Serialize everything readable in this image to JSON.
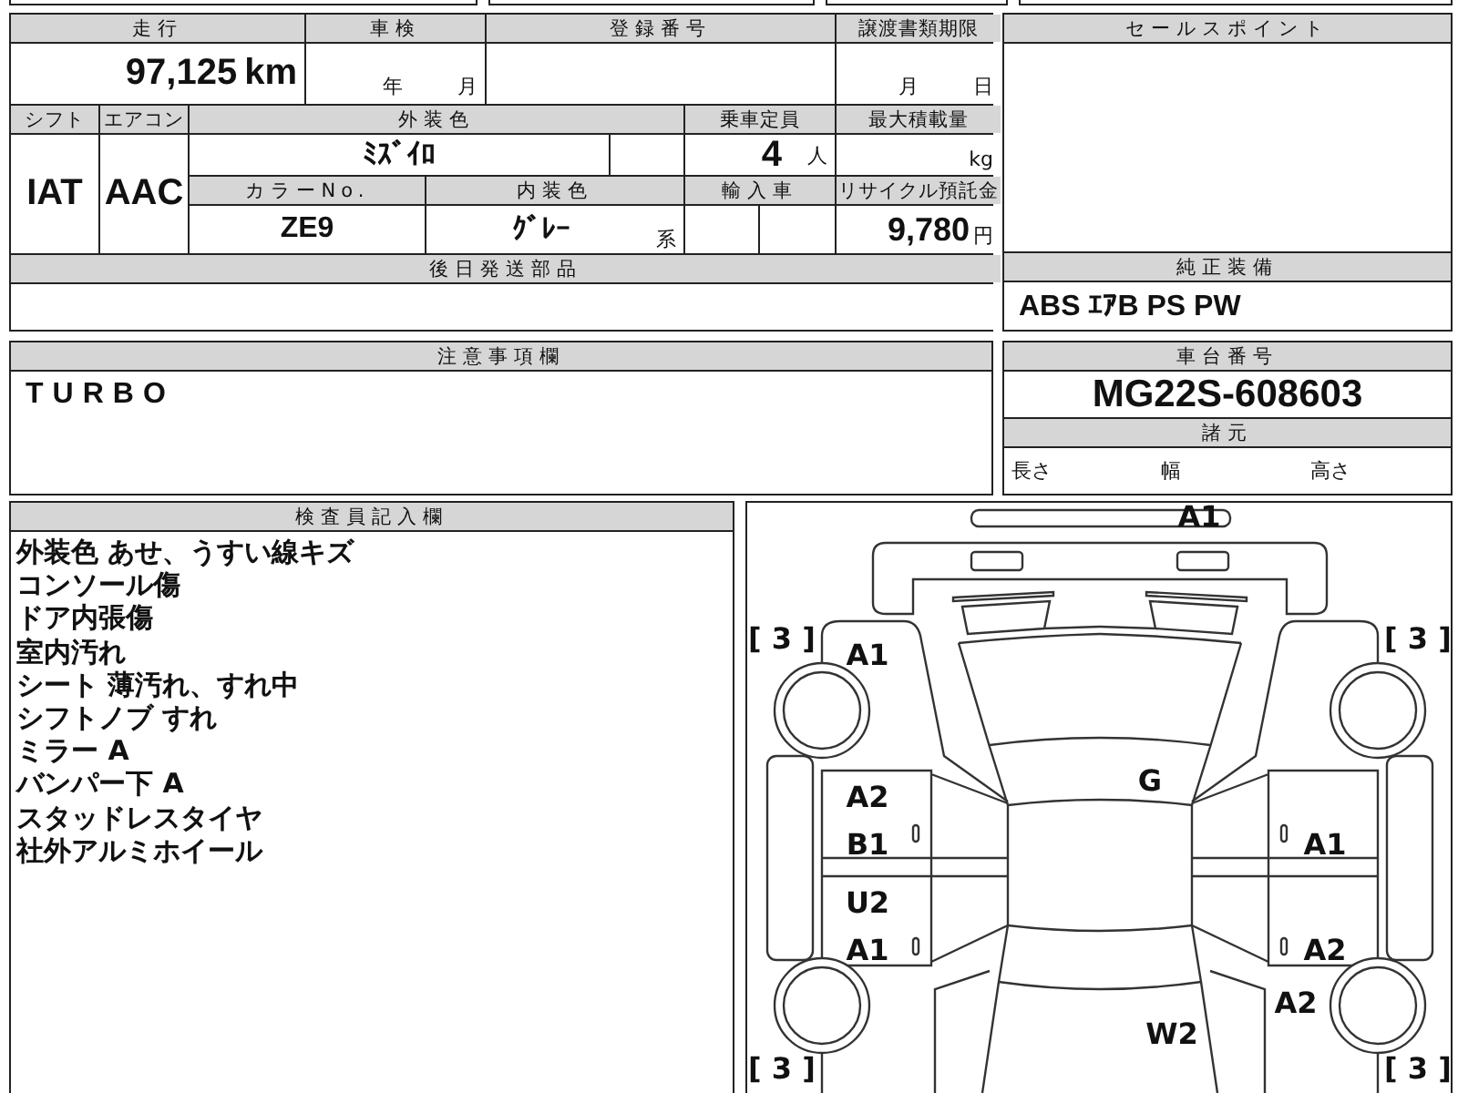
{
  "odometer": {
    "label": "走行",
    "value": "97,125",
    "unit": "km"
  },
  "inspection": {
    "label": "車検",
    "year_unit": "年",
    "month_unit": "月"
  },
  "registration": {
    "label": "登録番号"
  },
  "transfer_deadline": {
    "label": "譲渡書類期限",
    "month_unit": "月",
    "day_unit": "日"
  },
  "shift": {
    "label": "シフト",
    "value": "IAT"
  },
  "aircon": {
    "label": "エアコン",
    "value": "AAC"
  },
  "exterior_color": {
    "label": "外装色",
    "value": "ﾐｽﾞｲﾛ"
  },
  "capacity": {
    "label": "乗車定員",
    "value": "4",
    "unit": "人"
  },
  "max_load": {
    "label": "最大積載量",
    "unit": "kg"
  },
  "color_no": {
    "label": "カラーNo.",
    "value": "ZE9"
  },
  "interior_color": {
    "label": "内装色",
    "value": "ｸﾞﾚｰ",
    "suffix": "系"
  },
  "imported": {
    "label": "輸入車"
  },
  "recycle_fee": {
    "label": "リサイクル預託金",
    "value": "9,780",
    "unit": "円"
  },
  "later_parts": {
    "label": "後日発送部品"
  },
  "sales_point": {
    "label": "セールスポイント"
  },
  "equipment": {
    "label": "純正装備",
    "value": "ABS ｴｱB PS PW"
  },
  "notes": {
    "label": "注意事項欄",
    "value": "TURBO"
  },
  "chassis": {
    "label": "車台番号",
    "value": "MG22S-608603"
  },
  "specs": {
    "label": "諸元",
    "items": [
      "長さ",
      "幅",
      "高さ"
    ]
  },
  "inspector": {
    "label": "検査員記入欄",
    "lines": [
      "外装色 あせ、うすい線キズ",
      "コンソール傷",
      "ドア内張傷",
      "室内汚れ",
      "シート 薄汚れ、すれ中",
      "シフトノブ すれ",
      "ミラー A",
      "バンパー下 A",
      "スタッドレスタイヤ",
      "社外アルミホイール"
    ]
  },
  "diagram": {
    "marks": {
      "front_bumper": "A1",
      "left_front_fender": "A1",
      "windshield": "G",
      "left_front_door_upper": "A2",
      "left_front_door_lower": "B1",
      "right_front_door_lower": "A1",
      "left_rear_door_upper": "U2",
      "left_rear_door_lower": "A1",
      "right_rear_door_lower": "A2",
      "right_rear_fender": "A2",
      "rear": "W2"
    },
    "tires": {
      "front_left": "[ 3 ]",
      "front_right": "[ 3 ]",
      "rear_left": "[ 3 ]",
      "rear_right": "[ 3 ]"
    }
  }
}
